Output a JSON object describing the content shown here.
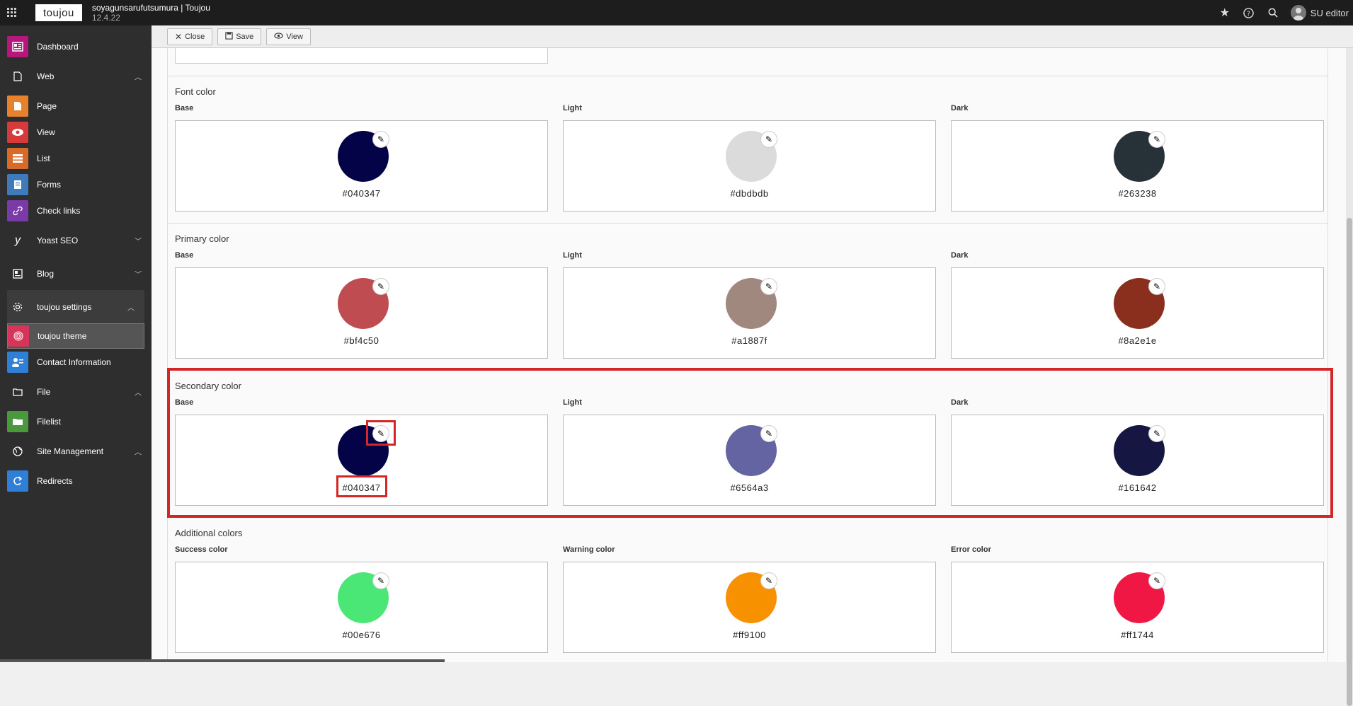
{
  "topbar": {
    "logo": "toujou",
    "site_name": "soyagunsarufutsumura | Toujou",
    "version": "12.4.22",
    "user": "SU editor"
  },
  "sidebar": {
    "items": [
      {
        "label": "Dashboard",
        "icon": "dashboard-icon",
        "color": "#b5177c"
      },
      {
        "label": "Web",
        "icon": "page-icon",
        "group": true
      },
      {
        "label": "Page",
        "icon": "page-icon",
        "color": "#e8812b"
      },
      {
        "label": "View",
        "icon": "eye-icon",
        "color": "#d73a3a"
      },
      {
        "label": "List",
        "icon": "list-icon",
        "color": "#d86a2a"
      },
      {
        "label": "Forms",
        "icon": "form-icon",
        "color": "#3f7bbb"
      },
      {
        "label": "Check links",
        "icon": "link-icon",
        "color": "#7a3aa8"
      },
      {
        "label": "Yoast SEO",
        "icon": "yoast-icon",
        "group": true
      },
      {
        "label": "Blog",
        "icon": "blog-icon",
        "group": true
      },
      {
        "label": "toujou settings",
        "icon": "gear-icon",
        "group": true
      },
      {
        "label": "toujou theme",
        "icon": "fingerprint-icon",
        "color": "#d6355a"
      },
      {
        "label": "Contact Information",
        "icon": "contact-icon",
        "color": "#2f7fd6"
      },
      {
        "label": "File",
        "icon": "file-icon",
        "group": true
      },
      {
        "label": "Filelist",
        "icon": "filelist-icon",
        "color": "#4a9a3d"
      },
      {
        "label": "Site Management",
        "icon": "globe-icon",
        "group": true
      },
      {
        "label": "Redirects",
        "icon": "redirect-icon",
        "color": "#2f7fd6"
      }
    ]
  },
  "toolbar": {
    "close_label": "Close",
    "save_label": "Save",
    "view_label": "View"
  },
  "sections": [
    {
      "title": "Font color",
      "columns": [
        {
          "label": "Base",
          "hex": "#040347"
        },
        {
          "label": "Light",
          "hex": "#dbdbdb"
        },
        {
          "label": "Dark",
          "hex": "#263238"
        }
      ]
    },
    {
      "title": "Primary color",
      "columns": [
        {
          "label": "Base",
          "hex": "#bf4c50"
        },
        {
          "label": "Light",
          "hex": "#a1887f"
        },
        {
          "label": "Dark",
          "hex": "#8a2e1e"
        }
      ]
    },
    {
      "title": "Secondary color",
      "columns": [
        {
          "label": "Base",
          "hex": "#040347"
        },
        {
          "label": "Light",
          "hex": "#6564a3"
        },
        {
          "label": "Dark",
          "hex": "#161642"
        }
      ]
    },
    {
      "title": "Additional colors",
      "columns": [
        {
          "label": "Success color",
          "hex": "#00e676"
        },
        {
          "label": "Warning color",
          "hex": "#ff9100"
        },
        {
          "label": "Error color",
          "hex": "#ff1744"
        }
      ]
    }
  ],
  "swatch_colors": {
    "font_base": "#040347",
    "font_light": "#dbdbdb",
    "font_dark": "#263238",
    "primary_base": "#bf4c50",
    "primary_light": "#a1887f",
    "primary_dark": "#8a2e1e",
    "secondary_base": "#040347",
    "secondary_light": "#6564a3",
    "secondary_dark": "#161642",
    "success": "#4ae676",
    "warning": "#f79100",
    "error": "#f01744"
  }
}
